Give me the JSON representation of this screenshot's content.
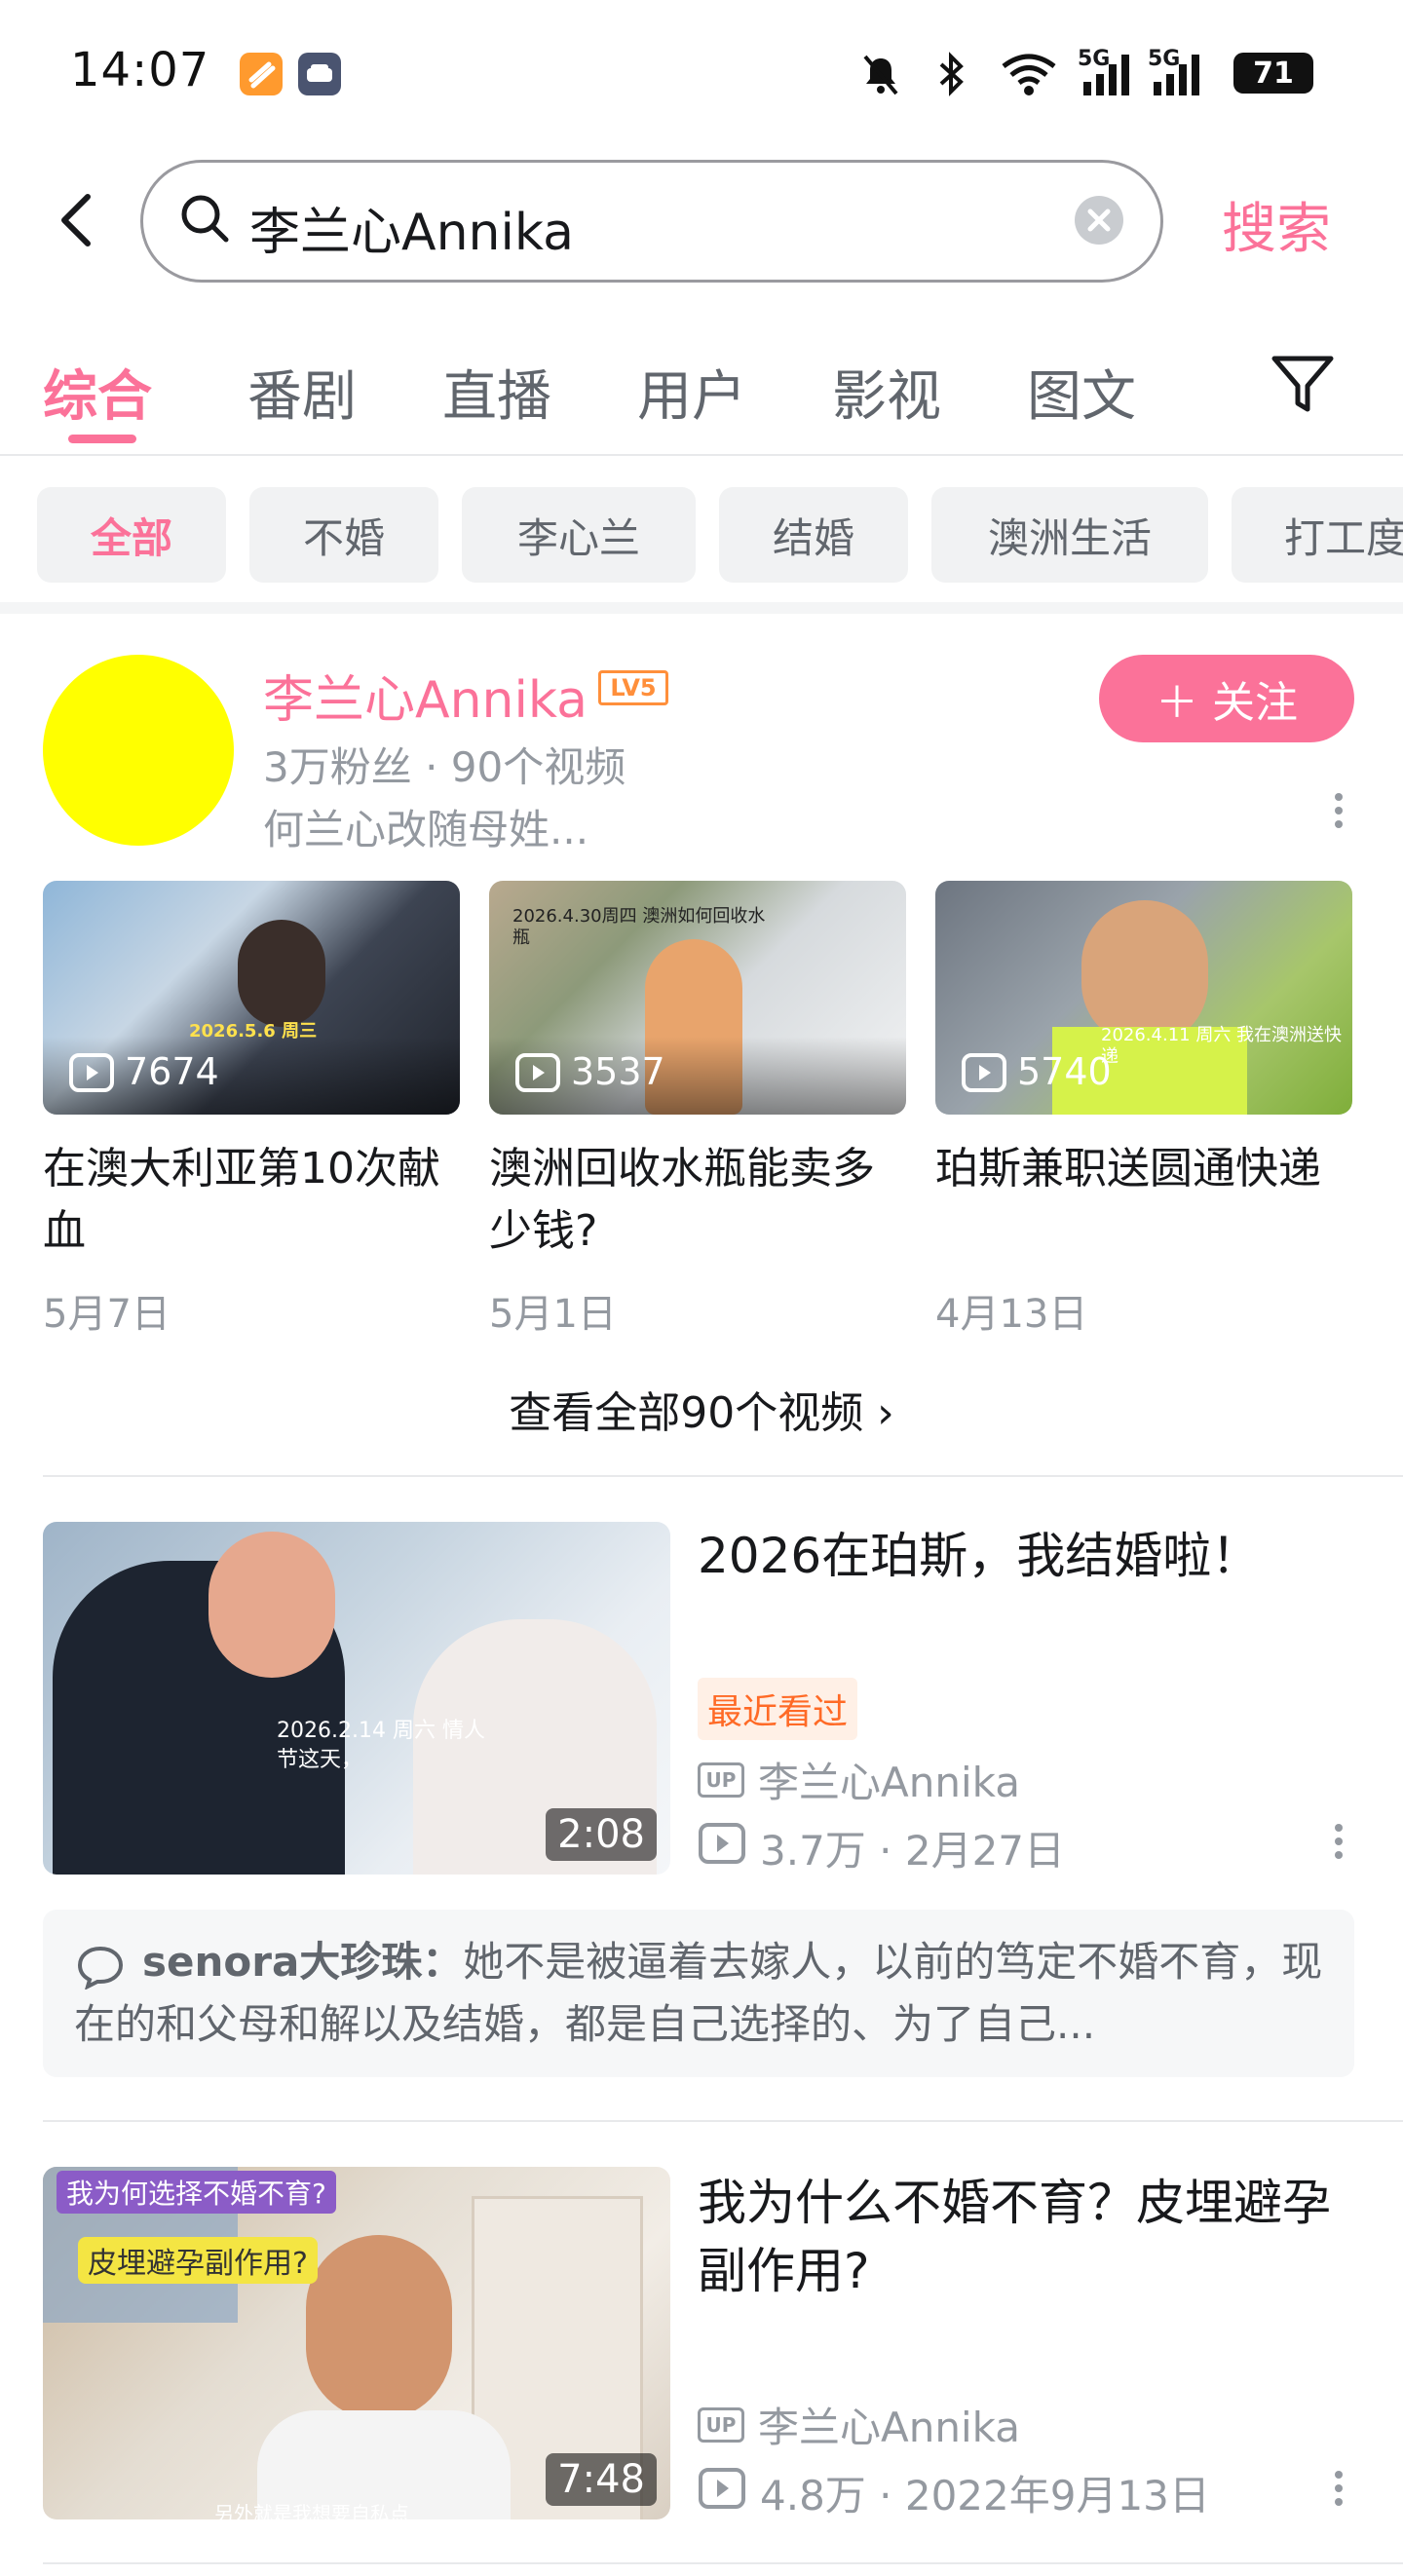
{
  "status_bar": {
    "time": "14:07",
    "signal1": "5G",
    "signal2": "5G",
    "battery": "71"
  },
  "search": {
    "query": "李兰心Annika",
    "submit_label": "搜索"
  },
  "tabs": [
    "综合",
    "番剧",
    "直播",
    "用户",
    "影视",
    "图文"
  ],
  "chips": [
    "全部",
    "不婚",
    "李心兰",
    "结婚",
    "澳洲生活",
    "打工度"
  ],
  "user_card": {
    "name": "李兰心Annika",
    "level": "LV5",
    "meta": "3万粉丝 · 90个视频",
    "desc": "何兰心改随母姓...",
    "follow_label": "＋ 关注",
    "videos": [
      {
        "plays": "7674",
        "title": "在澳大利亚第10次献血",
        "date": "5月7日",
        "overlay": "2026.5.6 周三"
      },
      {
        "plays": "3537",
        "title": "澳洲回收水瓶能卖多少钱?",
        "date": "5月1日",
        "overlay": "2026.4.30周四 澳洲如何回收水瓶"
      },
      {
        "plays": "5740",
        "title": "珀斯兼职送圆通快递",
        "date": "4月13日",
        "overlay": "2026.4.11 周六 我在澳洲送快递"
      }
    ],
    "see_all": "查看全部90个视频 ›"
  },
  "results": [
    {
      "title": "2026在珀斯，我结婚啦！",
      "badge": "最近看过",
      "up": "UP",
      "author": "李兰心Annika",
      "stats": "3.7万 · 2月27日",
      "duration": "2:08",
      "overlay": "2026.2.14 周六 情人节这天，"
    },
    {
      "title": "我为什么不婚不育？皮埋避孕副作用?",
      "up": "UP",
      "author": "李兰心Annika",
      "stats": "4.8万 · 2022年9月13日",
      "duration": "7:48",
      "overlay_top": "我为何选择不婚不育?",
      "overlay_mid": "皮埋避孕副作用?",
      "overlay_bottom": "另外就是我想要自私点"
    }
  ],
  "comment": {
    "user": "senora大珍珠：",
    "text": "她不是被逼着去嫁人，以前的笃定不婚不育，现在的和父母和解以及结婚，都是自己选择的、为了自己..."
  },
  "colors": {
    "accent": "#fb7299",
    "gray_text": "#9499a0",
    "chip_bg": "#f1f2f3"
  }
}
